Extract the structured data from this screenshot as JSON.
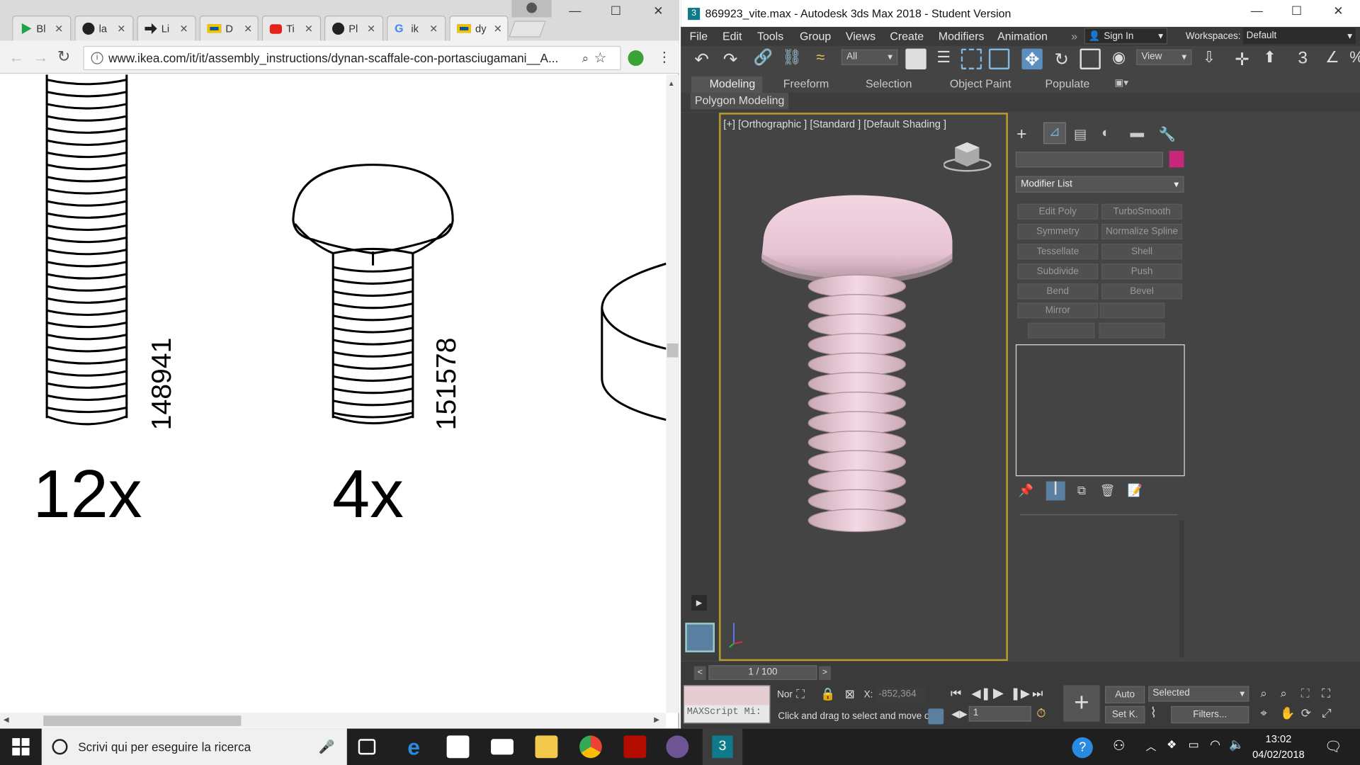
{
  "chrome": {
    "tabs": [
      {
        "label": "Bl",
        "icon": "play-icon",
        "color": "#1da34a"
      },
      {
        "label": "la",
        "icon": "github-icon",
        "color": "#222"
      },
      {
        "label": "Li",
        "icon": "arrow-icon",
        "color": "#222"
      },
      {
        "label": "D",
        "icon": "ikea-icon",
        "color": "#f4c300"
      },
      {
        "label": "Ti",
        "icon": "youtube-icon",
        "color": "#e62117"
      },
      {
        "label": "Pl",
        "icon": "github-icon",
        "color": "#222"
      },
      {
        "label": "ik",
        "icon": "google-icon",
        "color": "#4285f4"
      },
      {
        "label": "dy",
        "icon": "ikea-icon",
        "color": "#f4c300"
      }
    ],
    "url": "www.ikea.com/it/it/assembly_instructions/dynan-scaffale-con-portasciugamani__A...",
    "pdf": {
      "part1": {
        "code": "148941",
        "qty": "12x"
      },
      "part2": {
        "code": "151578",
        "qty": "4x"
      }
    }
  },
  "max": {
    "title": "869923_vite.max - Autodesk 3ds Max 2018 - Student Version",
    "menu": [
      "File",
      "Edit",
      "Tools",
      "Group",
      "Views",
      "Create",
      "Modifiers",
      "Animation"
    ],
    "sign_in": "Sign In",
    "workspaces_label": "Workspaces:",
    "workspace_value": "Default",
    "filter_all": "All",
    "view_dropdown": "View",
    "ribbon_tabs": [
      "Modeling",
      "Freeform",
      "Selection",
      "Object Paint",
      "Populate"
    ],
    "ribbon_panel": "Polygon Modeling",
    "viewport_label": "[+] [Orthographic ] [Standard ] [Default Shading ]",
    "object_color": "#c8287a",
    "screw_color": "#e9c6d4",
    "modifier_list": "Modifier List",
    "modifier_buttons": [
      "Edit Poly",
      "TurboSmooth",
      "Symmetry",
      "Normalize Spline",
      "Tessellate",
      "Shell",
      "Subdivide",
      "Push",
      "Bend",
      "Bevel",
      "Mirror"
    ],
    "time_slider": "1 / 100",
    "maxscript": "MAXScript Mi:",
    "status_prompt": "Click and drag to select and move ol",
    "coord_prefix": "Nor",
    "coord_x_label": "X:",
    "coord_x_value": "-852,364",
    "frame_value": "1",
    "auto_key": "Auto",
    "set_key": "Set K.",
    "selected_dropdown": "Selected",
    "filters": "Filters..."
  },
  "taskbar": {
    "search_placeholder": "Scrivi qui per eseguire la ricerca",
    "time": "13:02",
    "date": "04/02/2018"
  }
}
